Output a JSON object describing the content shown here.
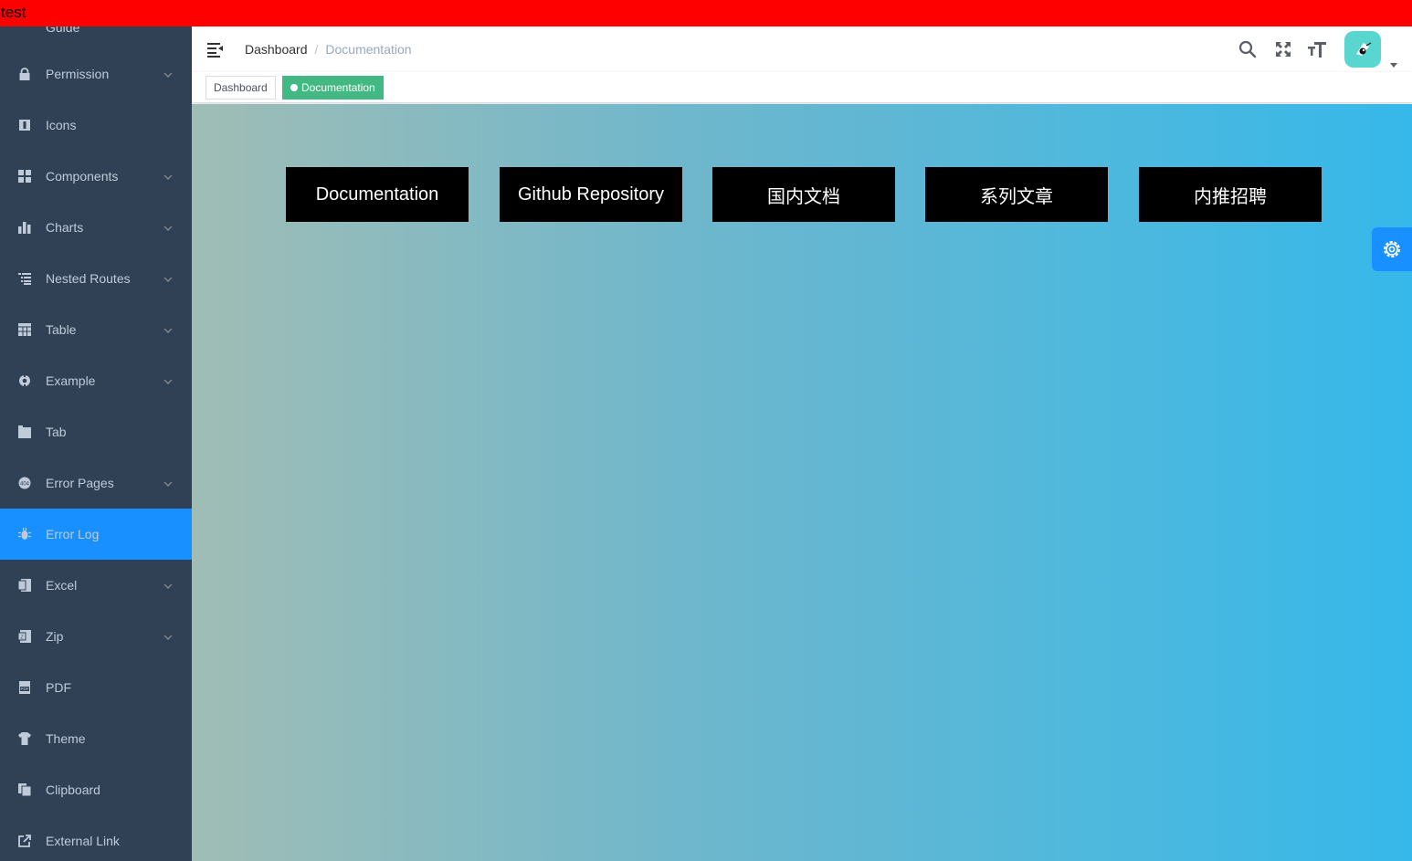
{
  "banner": {
    "text": "test"
  },
  "sidebar": {
    "partial_item_label": "Guide",
    "items": [
      {
        "label": "Permission",
        "icon": "lock-icon",
        "has_children": true,
        "active": false
      },
      {
        "label": "Icons",
        "icon": "icon-icon",
        "has_children": false,
        "active": false
      },
      {
        "label": "Components",
        "icon": "component-icon",
        "has_children": true,
        "active": false
      },
      {
        "label": "Charts",
        "icon": "chart-icon",
        "has_children": true,
        "active": false
      },
      {
        "label": "Nested Routes",
        "icon": "nested-icon",
        "has_children": true,
        "active": false
      },
      {
        "label": "Table",
        "icon": "table-icon",
        "has_children": true,
        "active": false
      },
      {
        "label": "Example",
        "icon": "example-icon",
        "has_children": true,
        "active": false
      },
      {
        "label": "Tab",
        "icon": "tab-icon",
        "has_children": false,
        "active": false
      },
      {
        "label": "Error Pages",
        "icon": "404-icon",
        "has_children": true,
        "active": false
      },
      {
        "label": "Error Log",
        "icon": "bug-icon",
        "has_children": false,
        "active": true
      },
      {
        "label": "Excel",
        "icon": "excel-icon",
        "has_children": true,
        "active": false
      },
      {
        "label": "Zip",
        "icon": "zip-icon",
        "has_children": true,
        "active": false
      },
      {
        "label": "PDF",
        "icon": "pdf-icon",
        "has_children": false,
        "active": false
      },
      {
        "label": "Theme",
        "icon": "shirt-icon",
        "has_children": false,
        "active": false
      },
      {
        "label": "Clipboard",
        "icon": "clipboard-icon",
        "has_children": false,
        "active": false
      },
      {
        "label": "External Link",
        "icon": "external-link-icon",
        "has_children": false,
        "active": false
      }
    ]
  },
  "navbar": {
    "breadcrumb": {
      "home": "Dashboard",
      "separator": "/",
      "current": "Documentation"
    },
    "icons": [
      "search-icon",
      "fullscreen-icon",
      "text-size-icon"
    ]
  },
  "tags": [
    {
      "label": "Dashboard",
      "active": false
    },
    {
      "label": "Documentation",
      "active": true
    }
  ],
  "main": {
    "buttons": [
      "Documentation",
      "Github Repository",
      "国内文档",
      "系列文章",
      "内推招聘"
    ]
  },
  "colors": {
    "sidebar_bg": "#304156",
    "sidebar_active": "#1890ff",
    "tag_active": "#42b983",
    "banner": "#ff0000",
    "settings_btn": "#1890ff"
  }
}
